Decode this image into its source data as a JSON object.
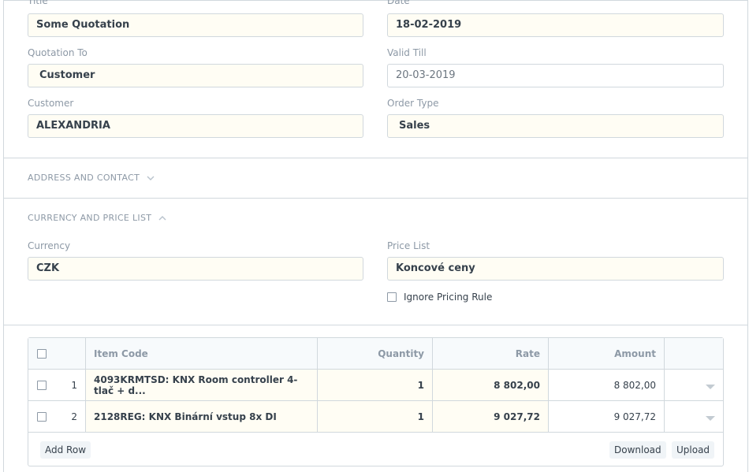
{
  "fields": {
    "title": {
      "label": "Title",
      "value": "Some Quotation"
    },
    "date": {
      "label": "Date",
      "value": "18-02-2019"
    },
    "quotation_to": {
      "label": "Quotation To",
      "value": "Customer"
    },
    "valid_till": {
      "label": "Valid Till",
      "value": "20-03-2019"
    },
    "customer": {
      "label": "Customer",
      "value": "ALEXANDRIA"
    },
    "order_type": {
      "label": "Order Type",
      "value": "Sales"
    },
    "currency": {
      "label": "Currency",
      "value": "CZK"
    },
    "price_list": {
      "label": "Price List",
      "value": "Koncové ceny"
    },
    "ignore_pricing_rule": {
      "label": "Ignore Pricing Rule",
      "checked": false
    }
  },
  "sections": {
    "address_contact": {
      "title": "ADDRESS AND CONTACT",
      "collapsed": true,
      "icon": "chevron-down-icon"
    },
    "currency_price_list": {
      "title": "CURRENCY AND PRICE LIST",
      "collapsed": false,
      "icon": "chevron-up-icon"
    }
  },
  "items_table": {
    "columns": {
      "item_code": "Item Code",
      "quantity": "Quantity",
      "rate": "Rate",
      "amount": "Amount"
    },
    "rows": [
      {
        "idx": "1",
        "item_code": "4093KRMTSD: KNX Room controller 4-tlač + d...",
        "quantity": "1",
        "rate": "8 802,00",
        "amount": "8 802,00"
      },
      {
        "idx": "2",
        "item_code": "2128REG: KNX Binární vstup 8x DI",
        "quantity": "1",
        "rate": "9 027,72",
        "amount": "9 027,72"
      }
    ],
    "buttons": {
      "add_row": "Add Row",
      "download": "Download",
      "upload": "Upload"
    }
  }
}
